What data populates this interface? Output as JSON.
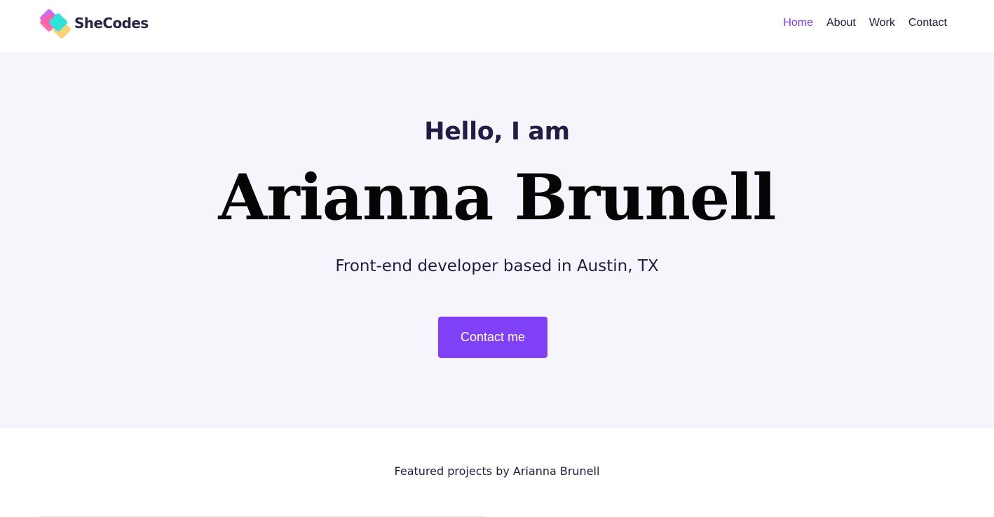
{
  "header": {
    "logo_text": "SheCodes",
    "logo_colors": [
      "#c86cf0",
      "#ff5fa2",
      "#2ee2d6",
      "#ffd27a"
    ],
    "nav": [
      {
        "label": "Home",
        "active": true
      },
      {
        "label": "About",
        "active": false
      },
      {
        "label": "Work",
        "active": false
      },
      {
        "label": "Contact",
        "active": false
      }
    ]
  },
  "hero": {
    "greeting": "Hello, I am",
    "name": "Arianna Brunell",
    "subtitle": "Front-end developer based in Austin, TX",
    "cta_label": "Contact me"
  },
  "featured": {
    "title": "Featured projects by Arianna Brunell"
  },
  "colors": {
    "accent": "#8040f7",
    "active_nav": "#7c3cf6",
    "hero_background": "#f7f5fc",
    "text_dark": "#241c45"
  }
}
